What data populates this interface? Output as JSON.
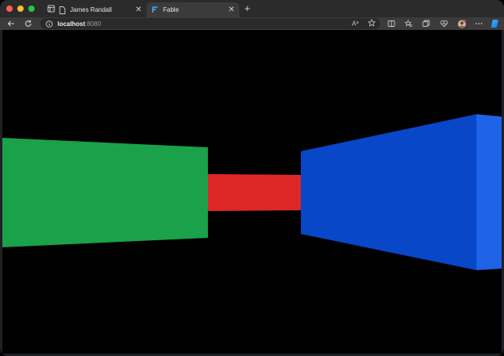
{
  "browser": {
    "tabs": [
      {
        "label": "James Randall",
        "active": false,
        "icon": "document-icon"
      },
      {
        "label": "Fable",
        "active": true,
        "icon": "fable-logo-icon"
      }
    ],
    "address": {
      "host": "localhost",
      "port": ":8080"
    },
    "toolbar_icons": [
      "read-aloud-icon",
      "favorite-star-icon",
      "split-screen-icon",
      "favorites-icon",
      "collections-icon",
      "browser-essentials-icon",
      "profile-avatar",
      "more-icon",
      "copilot-icon"
    ]
  },
  "scene": {
    "background": "#000000",
    "colors": {
      "green": "#1aa14a",
      "red": "#dd2727",
      "blue_front": "#0747c8",
      "blue_side": "#1e62e8"
    }
  }
}
